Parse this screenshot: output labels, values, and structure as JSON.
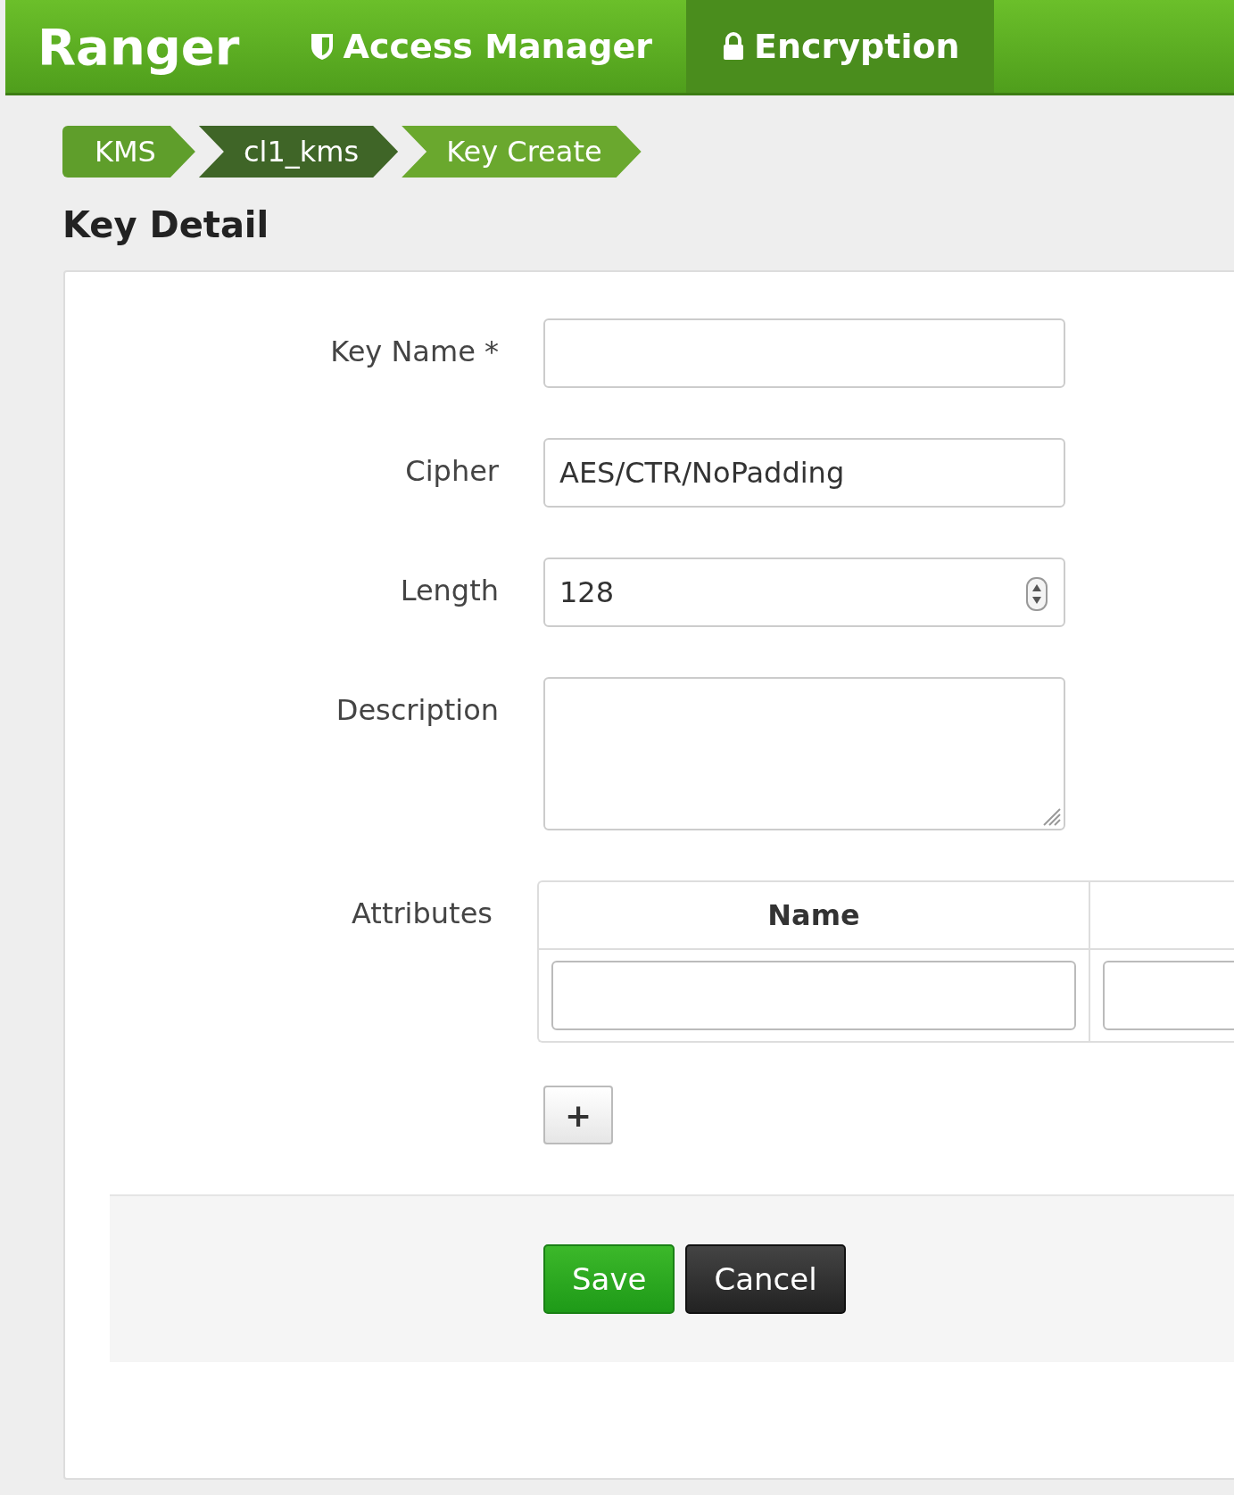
{
  "header": {
    "brand": "Ranger",
    "nav": [
      {
        "label": "Access Manager",
        "kind": "shield",
        "selected": false
      },
      {
        "label": "Encryption",
        "kind": "lock",
        "selected": true
      }
    ]
  },
  "breadcrumb": [
    {
      "label": "KMS",
      "color": "#5f9e2b"
    },
    {
      "label": "cl1_kms",
      "color": "#3f6527"
    },
    {
      "label": "Key Create",
      "color": "#6aa82e"
    }
  ],
  "page_title": "Key Detail",
  "fields": [
    {
      "kind": "text",
      "label": "Key Name *"
    },
    {
      "kind": "text",
      "label": "Cipher",
      "value": "AES/CTR/NoPadding"
    },
    {
      "kind": "number",
      "label": "Length",
      "value": "128"
    },
    {
      "kind": "textarea",
      "label": "Description"
    }
  ],
  "attributes": {
    "label": "Attributes",
    "columns": [
      "Name"
    ]
  },
  "add_button": "+",
  "buttons": [
    {
      "label": "Save",
      "kind": "primary"
    },
    {
      "label": "Cancel",
      "kind": "dark"
    }
  ]
}
